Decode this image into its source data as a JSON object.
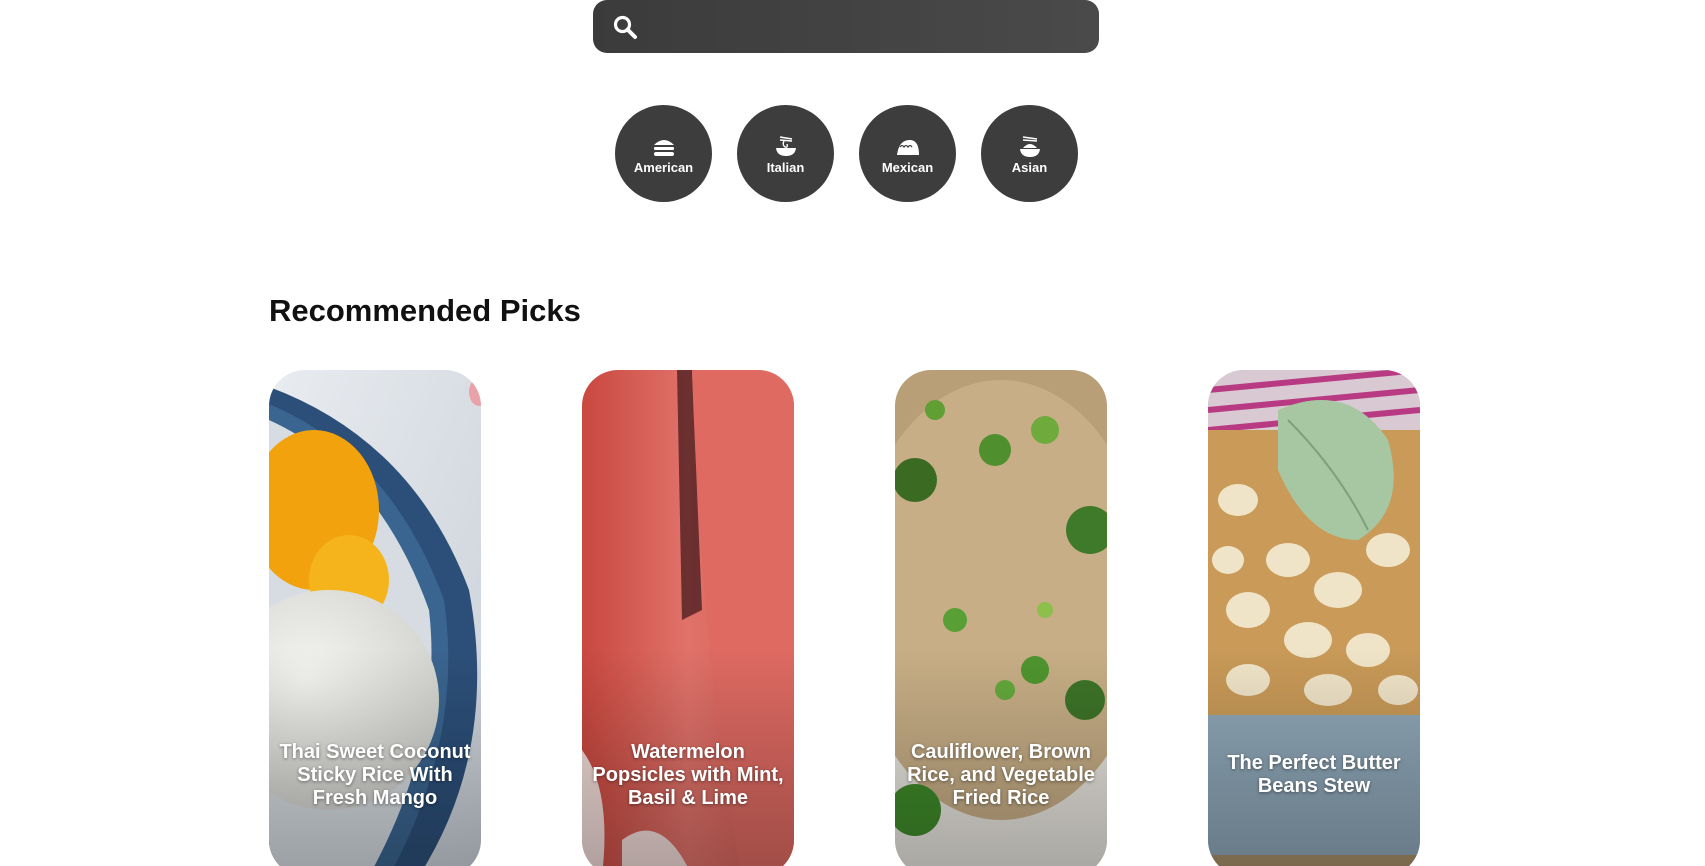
{
  "search": {
    "value": "",
    "placeholder": ""
  },
  "cuisines": [
    {
      "label": "American",
      "icon": "burger-icon"
    },
    {
      "label": "Italian",
      "icon": "noodle-bowl-icon"
    },
    {
      "label": "Mexican",
      "icon": "taco-icon"
    },
    {
      "label": "Asian",
      "icon": "rice-bowl-icon"
    }
  ],
  "recommended": {
    "heading": "Recommended Picks",
    "items": [
      {
        "title": "Thai Sweet Coconut Sticky Rice With Fresh Mango"
      },
      {
        "title": "Watermelon Popsicles with Mint, Basil & Lime"
      },
      {
        "title": "Cauliflower, Brown Rice, and Vegetable Fried Rice"
      },
      {
        "title": "The Perfect Butter Beans Stew"
      }
    ]
  },
  "colors": {
    "search_bg": "#3b3b3b",
    "cuisine_bg": "#3d3d3d",
    "heading": "#111111"
  }
}
